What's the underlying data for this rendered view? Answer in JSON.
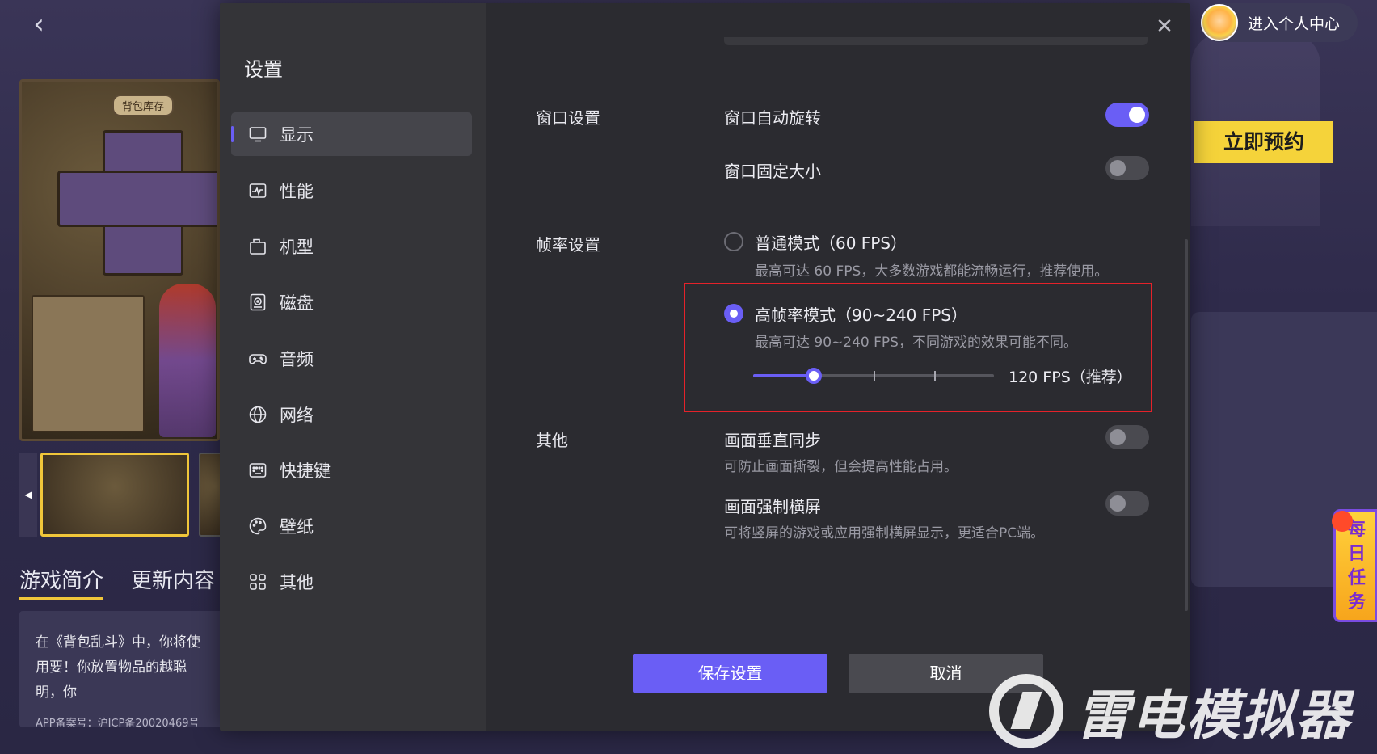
{
  "background": {
    "back_icon": "chevron-left-icon",
    "game_bag_label": "背包库存",
    "tabs": [
      "游戏简介",
      "更新内容"
    ],
    "intro_text": "在《背包乱斗》中，你将使用要！你放置物品的越聪明，你",
    "icp_text": "APP备案号：沪ICP备20020469号",
    "user_center_label": "进入个人中心",
    "reserve_label": "立即预约",
    "daily_task_label": "每日任务",
    "watermark_text": "雷电模拟器"
  },
  "modal": {
    "title": "设置",
    "close_icon": "close-icon",
    "nav": [
      {
        "label": "显示",
        "icon": "monitor-icon",
        "active": true
      },
      {
        "label": "性能",
        "icon": "performance-icon",
        "active": false
      },
      {
        "label": "机型",
        "icon": "device-model-icon",
        "active": false
      },
      {
        "label": "磁盘",
        "icon": "disk-icon",
        "active": false
      },
      {
        "label": "音频",
        "icon": "gamepad-icon",
        "active": false
      },
      {
        "label": "网络",
        "icon": "globe-icon",
        "active": false
      },
      {
        "label": "快捷键",
        "icon": "keyboard-icon",
        "active": false
      },
      {
        "label": "壁纸",
        "icon": "palette-icon",
        "active": false
      },
      {
        "label": "其他",
        "icon": "grid-icon",
        "active": false
      }
    ],
    "window_settings": {
      "section": "窗口设置",
      "auto_rotate": {
        "label": "窗口自动旋转",
        "on": true
      },
      "fixed_size": {
        "label": "窗口固定大小",
        "on": false
      }
    },
    "fps_settings": {
      "section": "帧率设置",
      "normal": {
        "label": "普通模式（60 FPS）",
        "desc": "最高可达 60 FPS，大多数游戏都能流畅运行，推荐使用。",
        "selected": false
      },
      "high": {
        "label": "高帧率模式（90~240 FPS）",
        "desc": "最高可达 90~240 FPS，不同游戏的效果可能不同。",
        "selected": true
      },
      "slider_value": "120 FPS（推荐）",
      "slider_position": 0.25
    },
    "other": {
      "section": "其他",
      "vsync": {
        "label": "画面垂直同步",
        "desc": "可防止画面撕裂，但会提高性能占用。",
        "on": false
      },
      "force_landscape": {
        "label": "画面强制横屏",
        "desc": "可将竖屏的游戏或应用强制横屏显示，更适合PC端。",
        "on": false
      }
    },
    "save_label": "保存设置",
    "cancel_label": "取消"
  },
  "colors": {
    "accent": "#6a5ef5",
    "highlight_border": "#e5222a",
    "reserve_yellow": "#f5d33a"
  }
}
